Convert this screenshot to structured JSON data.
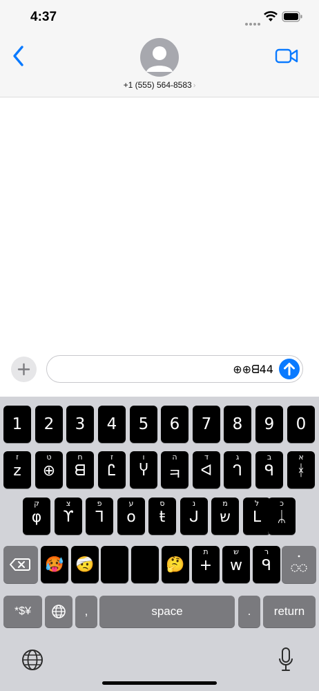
{
  "status": {
    "time": "4:37"
  },
  "header": {
    "contact": "+1 (555) 564-8583",
    "chevron": "›"
  },
  "compose": {
    "text": "⊕⊕ᗺ44"
  },
  "keyboard": {
    "numbers": [
      "1",
      "2",
      "3",
      "4",
      "5",
      "6",
      "7",
      "8",
      "9",
      "0"
    ],
    "row2": [
      {
        "sup": "ז",
        "main": "z"
      },
      {
        "sup": "ט",
        "main": "⊕"
      },
      {
        "sup": "ח",
        "main": "ᗺ"
      },
      {
        "sup": "ז",
        "main": "Ꮭ"
      },
      {
        "sup": "ו",
        "main": "Ⴤ"
      },
      {
        "sup": "ה",
        "main": "ㅋ"
      },
      {
        "sup": "ד",
        "main": "ᐊ"
      },
      {
        "sup": "ג",
        "main": "ᒉ"
      },
      {
        "sup": "ב",
        "main": "ᑫ"
      },
      {
        "sup": "א",
        "main": "ᚼ"
      }
    ],
    "row3": [
      {
        "sup": "ק",
        "main": "φ"
      },
      {
        "sup": "צ",
        "main": "ϒ"
      },
      {
        "sup": "פ",
        "main": "ᒣ"
      },
      {
        "sup": "ע",
        "main": "o"
      },
      {
        "sup": "ס",
        "main": "ŧ"
      },
      {
        "sup": "נ",
        "main": "ᒍ"
      },
      {
        "sup": "מ",
        "main": "ש"
      },
      {
        "sup": "ל",
        "main": "ᒪ"
      },
      {
        "sup": "כ",
        "main": "ᛦ"
      }
    ],
    "row4": [
      {
        "sup": "ת",
        "main": "+"
      },
      {
        "sup": "ש",
        "main": "w"
      },
      {
        "sup": "ר",
        "main": "ᑫ"
      }
    ],
    "emojis": [
      "🥵",
      "🤕",
      "😂",
      "😅",
      "🤔"
    ],
    "sym_label": "*$¥",
    "comma_label": ",",
    "space_label": "space",
    "period_label": ".",
    "return_label": "return"
  },
  "colors": {
    "accent": "#0a7aff",
    "key": "#000000",
    "keyboard_bg": "#d2d3d8"
  }
}
